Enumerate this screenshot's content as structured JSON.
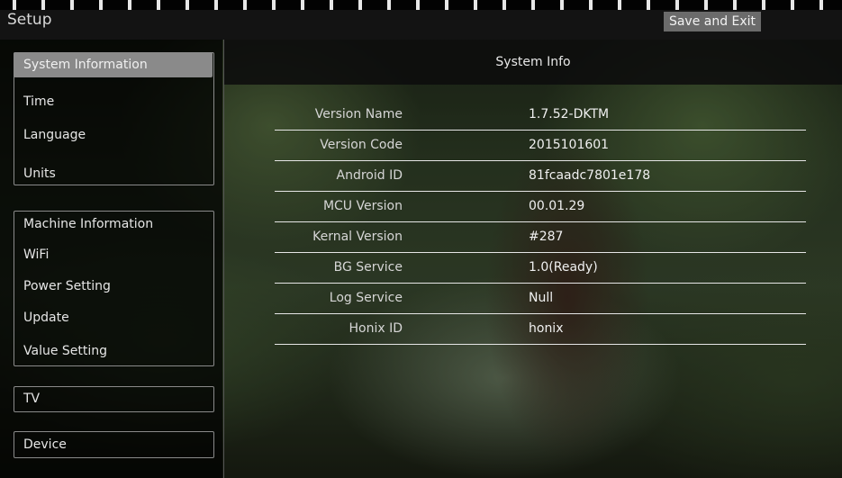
{
  "header": {
    "title": "Setup",
    "save_label": "Save and Exit"
  },
  "sidebar": {
    "groups": [
      {
        "items": [
          {
            "label": "System Information",
            "active": true
          },
          {
            "label": "Time"
          },
          {
            "label": "Language"
          },
          {
            "label": "Units"
          }
        ]
      },
      {
        "items": [
          {
            "label": "Machine Information"
          },
          {
            "label": "WiFi"
          },
          {
            "label": "Power Setting"
          },
          {
            "label": "Update"
          },
          {
            "label": "Value Setting"
          }
        ]
      },
      {
        "items": [
          {
            "label": "TV"
          }
        ]
      },
      {
        "items": [
          {
            "label": "Device"
          }
        ]
      }
    ]
  },
  "panel": {
    "title": "System Info",
    "rows": [
      {
        "label": "Version Name",
        "value": "1.7.52-DKTM"
      },
      {
        "label": "Version Code",
        "value": "2015101601"
      },
      {
        "label": "Android ID",
        "value": "81fcaadc7801e178"
      },
      {
        "label": "MCU Version",
        "value": "00.01.29"
      },
      {
        "label": "Kernal Version",
        "value": "#287"
      },
      {
        "label": "BG Service",
        "value": "1.0(Ready)"
      },
      {
        "label": "Log Service",
        "value": "Null"
      },
      {
        "label": "Honix ID",
        "value": "honix"
      }
    ]
  },
  "colors": {
    "active_item_bg": "#8a8a8a",
    "save_button_bg": "#6b6b6b",
    "row_divider": "#e6e6e6"
  }
}
